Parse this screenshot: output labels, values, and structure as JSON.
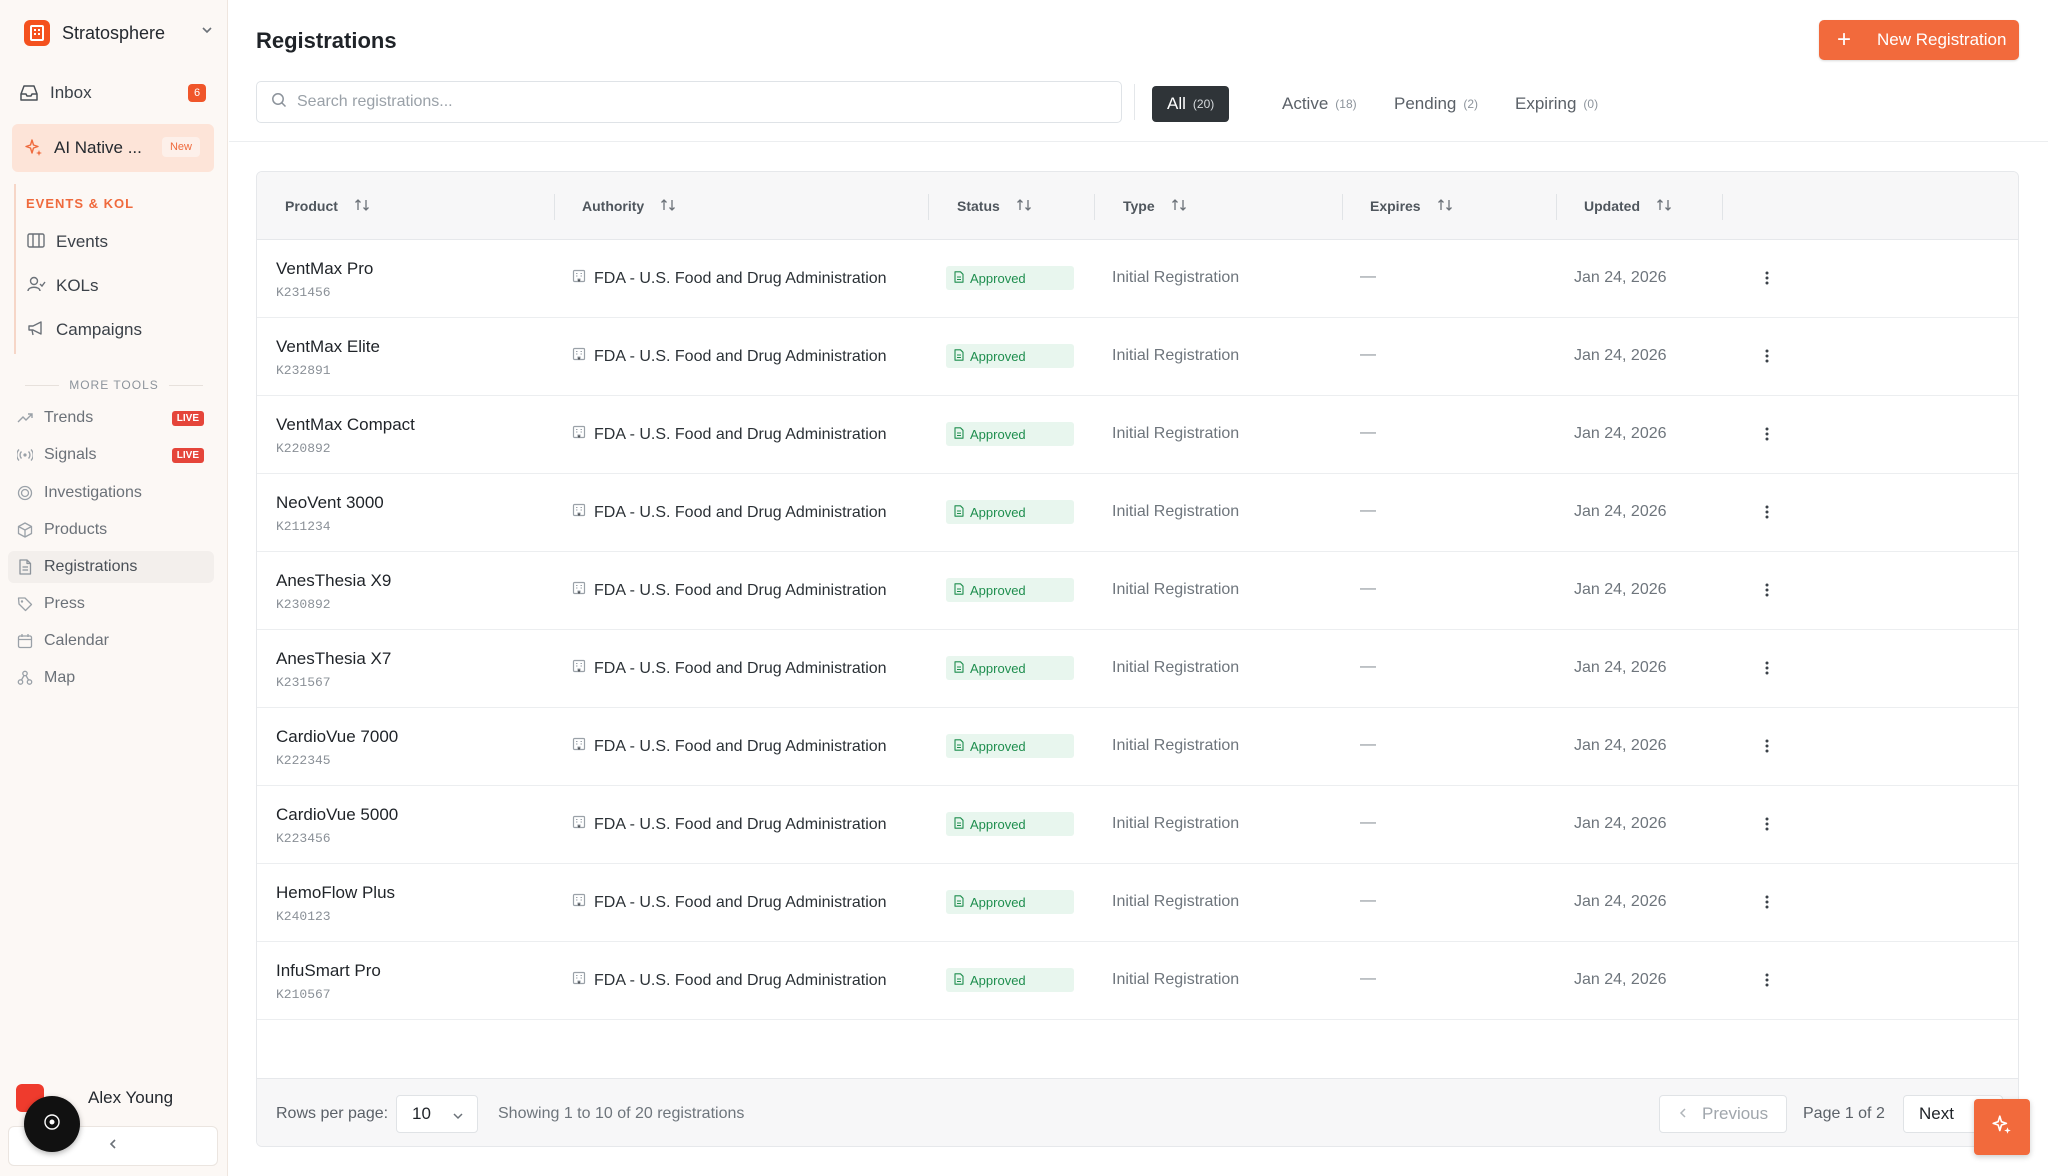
{
  "colors": {
    "accent": "#f26a3c",
    "success_bg": "#e8f6ee",
    "success_text": "#1e8e4e",
    "live": "#e5453a"
  },
  "sidebar": {
    "workspace_name": "Stratosphere",
    "inbox": {
      "label": "Inbox",
      "count": "6",
      "icon": "inbox-icon"
    },
    "ai_native": {
      "label": "AI Native ...",
      "badge": "New",
      "icon": "sparkles-icon"
    },
    "events_kol": {
      "title": "EVENTS & KOL",
      "items": [
        {
          "label": "Events",
          "icon": "calendar-box-icon"
        },
        {
          "label": "KOLs",
          "icon": "user-icon"
        },
        {
          "label": "Campaigns",
          "icon": "megaphone-icon"
        }
      ]
    },
    "more_tools": {
      "title": "MORE TOOLS",
      "items": [
        {
          "label": "Trends",
          "badge": "LIVE",
          "icon": "trend-icon"
        },
        {
          "label": "Signals",
          "badge": "LIVE",
          "icon": "radio-icon"
        },
        {
          "label": "Investigations",
          "icon": "target-icon"
        },
        {
          "label": "Products",
          "icon": "box-icon"
        },
        {
          "label": "Registrations",
          "icon": "document-icon",
          "active": true
        },
        {
          "label": "Press",
          "icon": "tag-icon"
        },
        {
          "label": "Calendar",
          "icon": "calendar-icon"
        },
        {
          "label": "Map",
          "icon": "map-icon"
        }
      ]
    },
    "user": {
      "name": "Alex Young"
    }
  },
  "header": {
    "title": "Registrations",
    "new_button_label": "New Registration",
    "search_placeholder": "Search registrations...",
    "tabs": [
      {
        "label": "All",
        "count": "(20)",
        "active": true
      },
      {
        "label": "Active",
        "count": "(18)"
      },
      {
        "label": "Pending",
        "count": "(2)"
      },
      {
        "label": "Expiring",
        "count": "(0)"
      }
    ]
  },
  "table": {
    "columns": [
      "Product",
      "Authority",
      "Status",
      "Type",
      "Expires",
      "Updated"
    ],
    "rows": [
      {
        "product": "VentMax Pro",
        "code": "K231456",
        "authority": "FDA - U.S. Food and Drug Administration",
        "status": "Approved",
        "type": "Initial Registration",
        "expires": "—",
        "updated": "Jan 24, 2026"
      },
      {
        "product": "VentMax Elite",
        "code": "K232891",
        "authority": "FDA - U.S. Food and Drug Administration",
        "status": "Approved",
        "type": "Initial Registration",
        "expires": "—",
        "updated": "Jan 24, 2026"
      },
      {
        "product": "VentMax Compact",
        "code": "K220892",
        "authority": "FDA - U.S. Food and Drug Administration",
        "status": "Approved",
        "type": "Initial Registration",
        "expires": "—",
        "updated": "Jan 24, 2026"
      },
      {
        "product": "NeoVent 3000",
        "code": "K211234",
        "authority": "FDA - U.S. Food and Drug Administration",
        "status": "Approved",
        "type": "Initial Registration",
        "expires": "—",
        "updated": "Jan 24, 2026"
      },
      {
        "product": "AnesThesia X9",
        "code": "K230892",
        "authority": "FDA - U.S. Food and Drug Administration",
        "status": "Approved",
        "type": "Initial Registration",
        "expires": "—",
        "updated": "Jan 24, 2026"
      },
      {
        "product": "AnesThesia X7",
        "code": "K231567",
        "authority": "FDA - U.S. Food and Drug Administration",
        "status": "Approved",
        "type": "Initial Registration",
        "expires": "—",
        "updated": "Jan 24, 2026"
      },
      {
        "product": "CardioVue 7000",
        "code": "K222345",
        "authority": "FDA - U.S. Food and Drug Administration",
        "status": "Approved",
        "type": "Initial Registration",
        "expires": "—",
        "updated": "Jan 24, 2026"
      },
      {
        "product": "CardioVue 5000",
        "code": "K223456",
        "authority": "FDA - U.S. Food and Drug Administration",
        "status": "Approved",
        "type": "Initial Registration",
        "expires": "—",
        "updated": "Jan 24, 2026"
      },
      {
        "product": "HemoFlow Plus",
        "code": "K240123",
        "authority": "FDA - U.S. Food and Drug Administration",
        "status": "Approved",
        "type": "Initial Registration",
        "expires": "—",
        "updated": "Jan 24, 2026"
      },
      {
        "product": "InfuSmart Pro",
        "code": "K210567",
        "authority": "FDA - U.S. Food and Drug Administration",
        "status": "Approved",
        "type": "Initial Registration",
        "expires": "—",
        "updated": "Jan 24, 2026"
      }
    ]
  },
  "pagination": {
    "rows_per_page_label": "Rows per page:",
    "rows_per_page_value": "10",
    "showing_text": "Showing 1 to 10 of 20 registrations",
    "previous_label": "Previous",
    "page_info": "Page 1 of 2",
    "next_label": "Next"
  }
}
